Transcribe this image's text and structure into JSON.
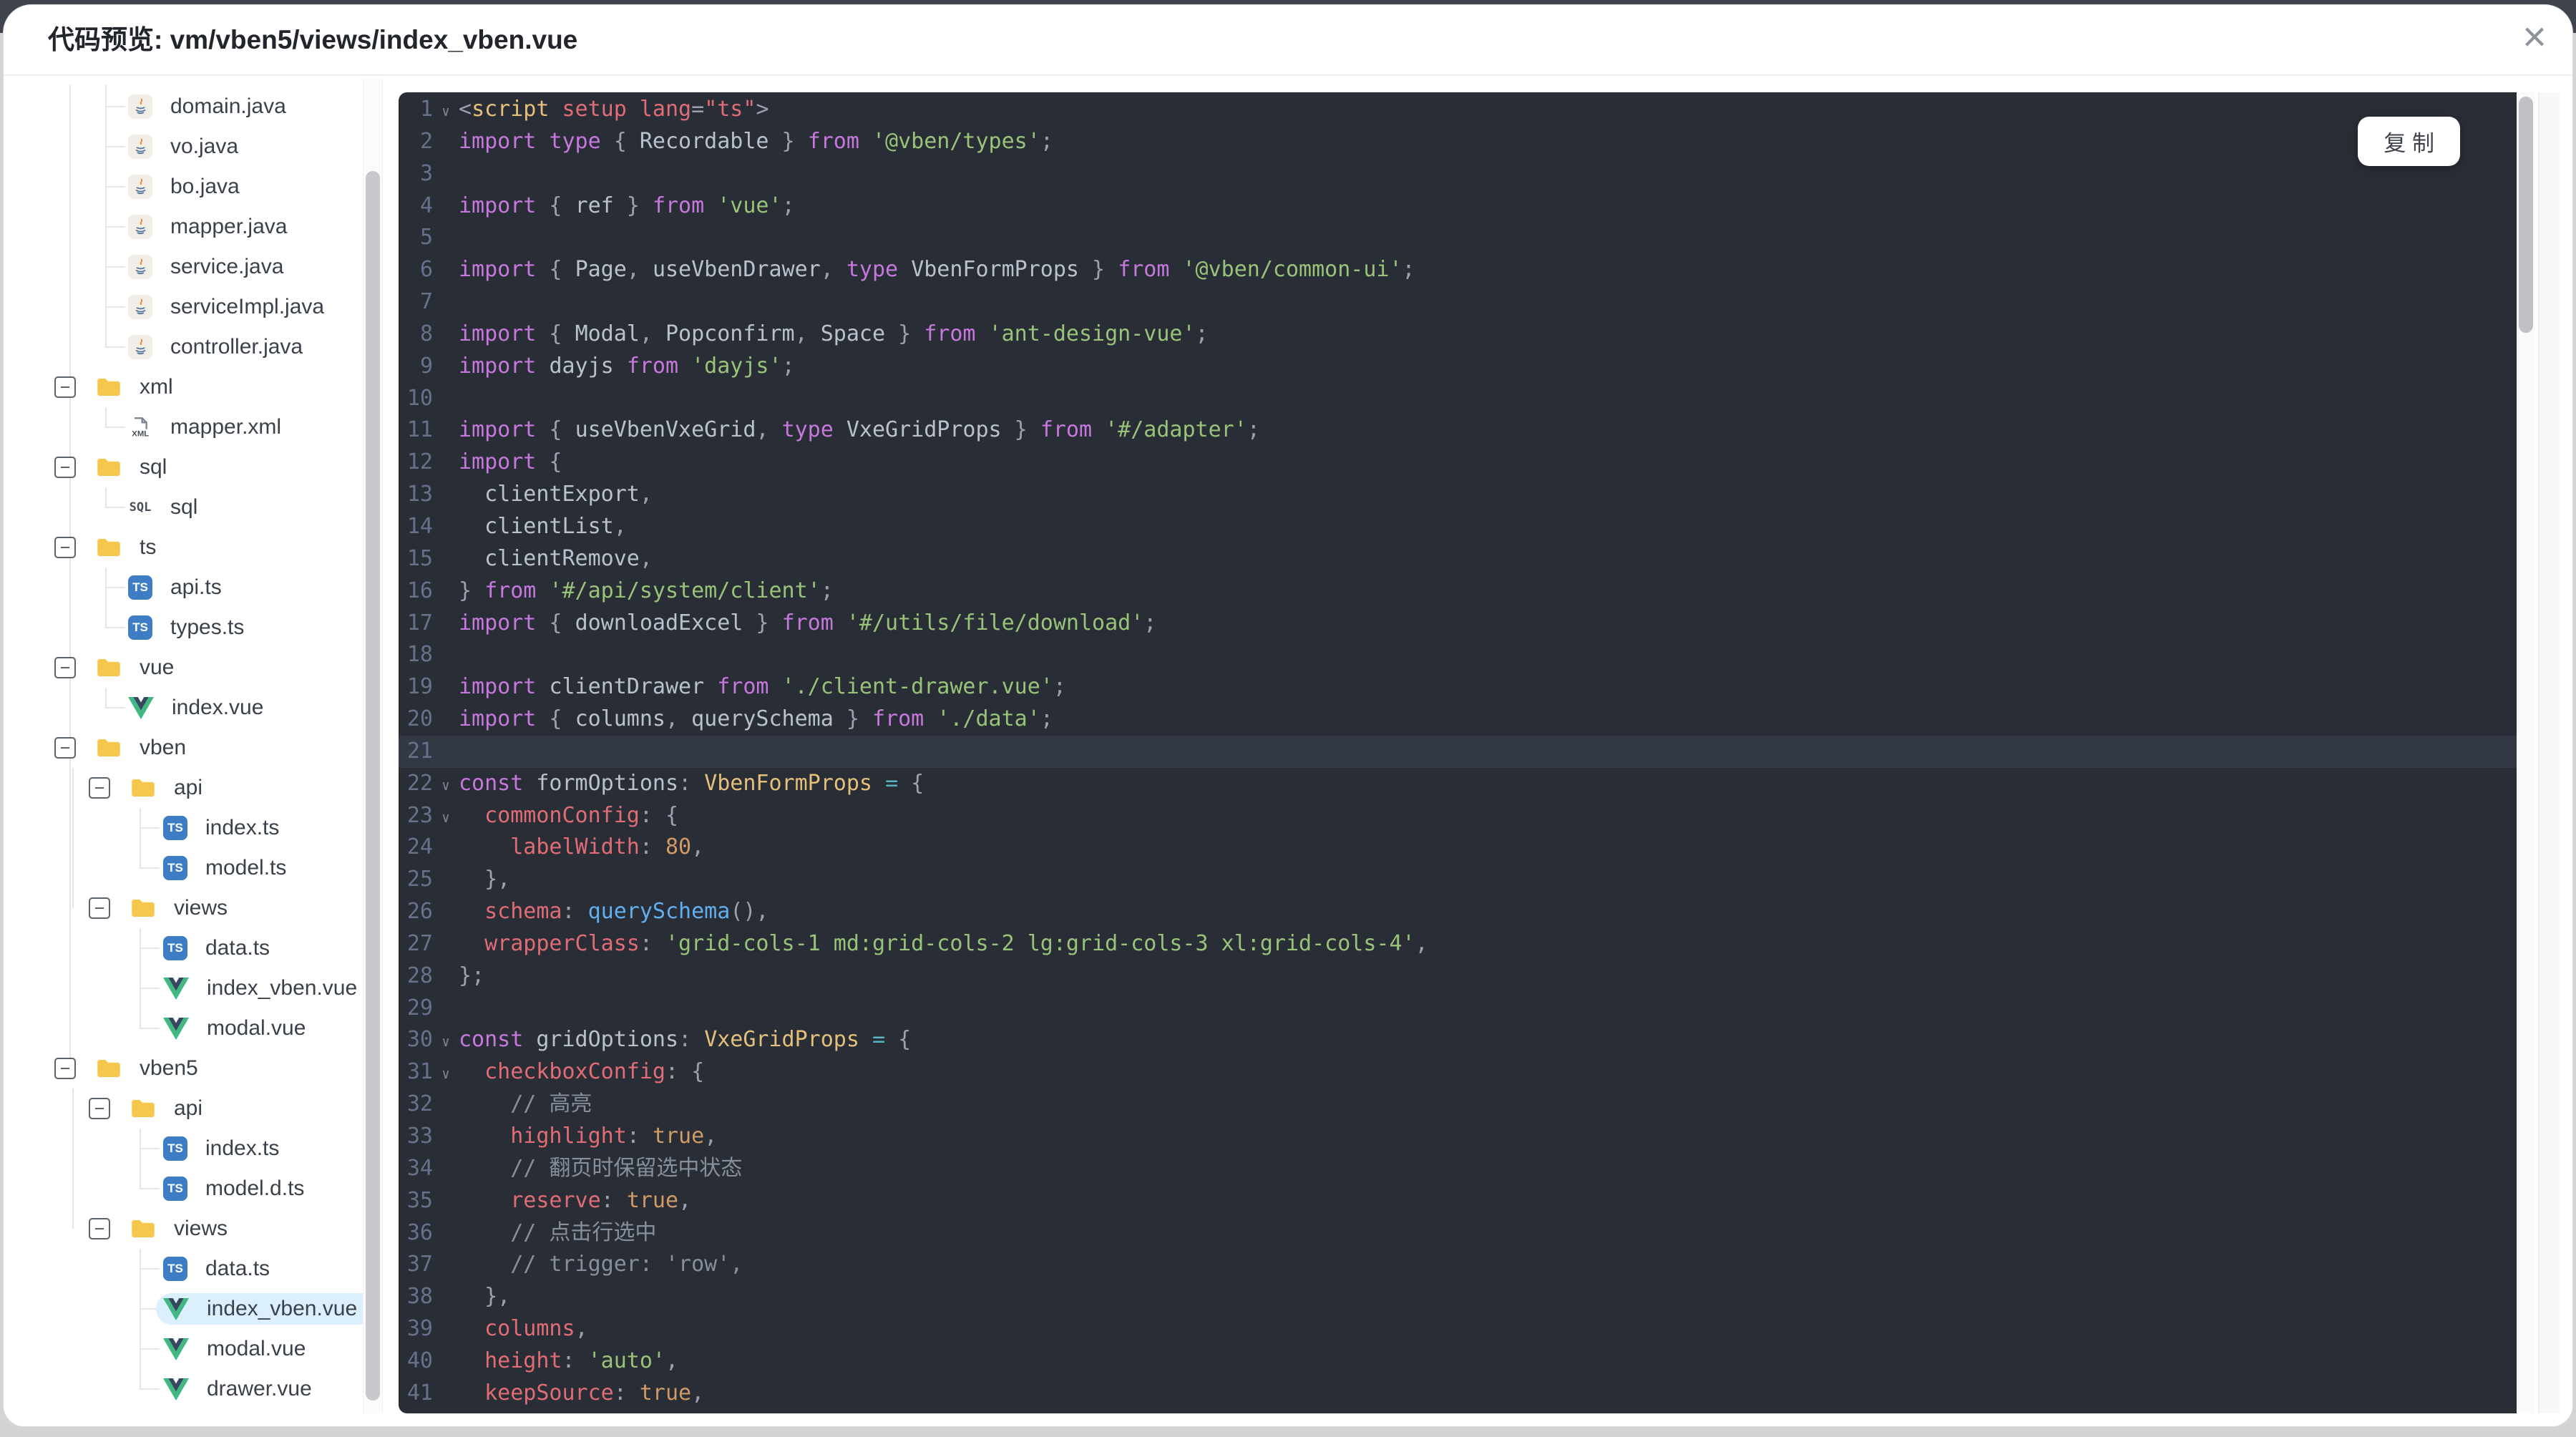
{
  "dialog": {
    "title": "代码预览: vm/vben5/views/index_vben.vue",
    "close_icon": "×"
  },
  "colors": {
    "code_background": "#292d36",
    "keyword": "#c678dd",
    "string": "#98c379",
    "property": "#e06c75",
    "number": "#d19a66",
    "type": "#e5c07b",
    "function": "#61afef",
    "selected_row_bg": "#dceffc",
    "folder_yellow": "#F7C64E",
    "ts_blue": "#3e7dc4",
    "vue_green": "#41B883"
  },
  "tree": {
    "rows": [
      {
        "label": "domain.java",
        "depth": 1,
        "kind": "java"
      },
      {
        "label": "vo.java",
        "depth": 1,
        "kind": "java"
      },
      {
        "label": "bo.java",
        "depth": 1,
        "kind": "java"
      },
      {
        "label": "mapper.java",
        "depth": 1,
        "kind": "java"
      },
      {
        "label": "service.java",
        "depth": 1,
        "kind": "java"
      },
      {
        "label": "serviceImpl.java",
        "depth": 1,
        "kind": "java"
      },
      {
        "label": "controller.java",
        "depth": 1,
        "kind": "java"
      },
      {
        "label": "xml",
        "depth": 0,
        "kind": "folder"
      },
      {
        "label": "mapper.xml",
        "depth": 1,
        "kind": "xml"
      },
      {
        "label": "sql",
        "depth": 0,
        "kind": "folder"
      },
      {
        "label": "sql",
        "depth": 1,
        "kind": "sql"
      },
      {
        "label": "ts",
        "depth": 0,
        "kind": "folder"
      },
      {
        "label": "api.ts",
        "depth": 1,
        "kind": "ts"
      },
      {
        "label": "types.ts",
        "depth": 1,
        "kind": "ts"
      },
      {
        "label": "vue",
        "depth": 0,
        "kind": "folder"
      },
      {
        "label": "index.vue",
        "depth": 1,
        "kind": "vue"
      },
      {
        "label": "vben",
        "depth": 0,
        "kind": "folder"
      },
      {
        "label": "api",
        "depth": 1,
        "kind": "folder"
      },
      {
        "label": "index.ts",
        "depth": 2,
        "kind": "ts"
      },
      {
        "label": "model.ts",
        "depth": 2,
        "kind": "ts"
      },
      {
        "label": "views",
        "depth": 1,
        "kind": "folder"
      },
      {
        "label": "data.ts",
        "depth": 2,
        "kind": "ts"
      },
      {
        "label": "index_vben.vue",
        "depth": 2,
        "kind": "vue"
      },
      {
        "label": "modal.vue",
        "depth": 2,
        "kind": "vue"
      },
      {
        "label": "vben5",
        "depth": 0,
        "kind": "folder"
      },
      {
        "label": "api",
        "depth": 1,
        "kind": "folder"
      },
      {
        "label": "index.ts",
        "depth": 2,
        "kind": "ts"
      },
      {
        "label": "model.d.ts",
        "depth": 2,
        "kind": "ts"
      },
      {
        "label": "views",
        "depth": 1,
        "kind": "folder"
      },
      {
        "label": "data.ts",
        "depth": 2,
        "kind": "ts"
      },
      {
        "label": "index_vben.vue",
        "depth": 2,
        "kind": "vue",
        "selected": true
      },
      {
        "label": "modal.vue",
        "depth": 2,
        "kind": "vue"
      },
      {
        "label": "drawer.vue",
        "depth": 2,
        "kind": "vue"
      }
    ]
  },
  "code": {
    "copy_label": "复 制",
    "lines": [
      {
        "n": 1,
        "fold": true,
        "tokens": [
          [
            "pn",
            "<"
          ],
          [
            "tag",
            "script"
          ],
          [
            "pn",
            " "
          ],
          [
            "attr",
            "setup"
          ],
          [
            "pn",
            " "
          ],
          [
            "attr",
            "lang"
          ],
          [
            "pn",
            "="
          ],
          [
            "attr",
            "\"ts\""
          ],
          [
            "pn",
            ">"
          ]
        ]
      },
      {
        "n": 2,
        "tokens": [
          [
            "kw",
            "import"
          ],
          [
            "pn",
            " "
          ],
          [
            "kw",
            "type"
          ],
          [
            "pn",
            " { "
          ],
          [
            "id",
            "Recordable"
          ],
          [
            "pn",
            " } "
          ],
          [
            "kw",
            "from"
          ],
          [
            "pn",
            " "
          ],
          [
            "str",
            "'@vben/types'"
          ],
          [
            "pn",
            ";"
          ]
        ]
      },
      {
        "n": 3,
        "tokens": []
      },
      {
        "n": 4,
        "tokens": [
          [
            "kw",
            "import"
          ],
          [
            "pn",
            " { "
          ],
          [
            "id",
            "ref"
          ],
          [
            "pn",
            " } "
          ],
          [
            "kw",
            "from"
          ],
          [
            "pn",
            " "
          ],
          [
            "str",
            "'vue'"
          ],
          [
            "pn",
            ";"
          ]
        ]
      },
      {
        "n": 5,
        "tokens": []
      },
      {
        "n": 6,
        "tokens": [
          [
            "kw",
            "import"
          ],
          [
            "pn",
            " { "
          ],
          [
            "id",
            "Page"
          ],
          [
            "pn",
            ", "
          ],
          [
            "id",
            "useVbenDrawer"
          ],
          [
            "pn",
            ", "
          ],
          [
            "kw",
            "type"
          ],
          [
            "pn",
            " "
          ],
          [
            "id",
            "VbenFormProps"
          ],
          [
            "pn",
            " } "
          ],
          [
            "kw",
            "from"
          ],
          [
            "pn",
            " "
          ],
          [
            "str",
            "'@vben/common-ui'"
          ],
          [
            "pn",
            ";"
          ]
        ]
      },
      {
        "n": 7,
        "tokens": []
      },
      {
        "n": 8,
        "tokens": [
          [
            "kw",
            "import"
          ],
          [
            "pn",
            " { "
          ],
          [
            "id",
            "Modal"
          ],
          [
            "pn",
            ", "
          ],
          [
            "id",
            "Popconfirm"
          ],
          [
            "pn",
            ", "
          ],
          [
            "id",
            "Space"
          ],
          [
            "pn",
            " } "
          ],
          [
            "kw",
            "from"
          ],
          [
            "pn",
            " "
          ],
          [
            "str",
            "'ant-design-vue'"
          ],
          [
            "pn",
            ";"
          ]
        ]
      },
      {
        "n": 9,
        "tokens": [
          [
            "kw",
            "import"
          ],
          [
            "pn",
            " "
          ],
          [
            "id",
            "dayjs"
          ],
          [
            "pn",
            " "
          ],
          [
            "kw",
            "from"
          ],
          [
            "pn",
            " "
          ],
          [
            "str",
            "'dayjs'"
          ],
          [
            "pn",
            ";"
          ]
        ]
      },
      {
        "n": 10,
        "tokens": []
      },
      {
        "n": 11,
        "tokens": [
          [
            "kw",
            "import"
          ],
          [
            "pn",
            " { "
          ],
          [
            "id",
            "useVbenVxeGrid"
          ],
          [
            "pn",
            ", "
          ],
          [
            "kw",
            "type"
          ],
          [
            "pn",
            " "
          ],
          [
            "id",
            "VxeGridProps"
          ],
          [
            "pn",
            " } "
          ],
          [
            "kw",
            "from"
          ],
          [
            "pn",
            " "
          ],
          [
            "str",
            "'#/adapter'"
          ],
          [
            "pn",
            ";"
          ]
        ]
      },
      {
        "n": 12,
        "tokens": [
          [
            "kw",
            "import"
          ],
          [
            "pn",
            " {"
          ]
        ]
      },
      {
        "n": 13,
        "tokens": [
          [
            "pn",
            "  "
          ],
          [
            "id",
            "clientExport"
          ],
          [
            "pn",
            ","
          ]
        ]
      },
      {
        "n": 14,
        "tokens": [
          [
            "pn",
            "  "
          ],
          [
            "id",
            "clientList"
          ],
          [
            "pn",
            ","
          ]
        ]
      },
      {
        "n": 15,
        "tokens": [
          [
            "pn",
            "  "
          ],
          [
            "id",
            "clientRemove"
          ],
          [
            "pn",
            ","
          ]
        ]
      },
      {
        "n": 16,
        "tokens": [
          [
            "pn",
            "} "
          ],
          [
            "kw",
            "from"
          ],
          [
            "pn",
            " "
          ],
          [
            "str",
            "'#/api/system/client'"
          ],
          [
            "pn",
            ";"
          ]
        ]
      },
      {
        "n": 17,
        "tokens": [
          [
            "kw",
            "import"
          ],
          [
            "pn",
            " { "
          ],
          [
            "id",
            "downloadExcel"
          ],
          [
            "pn",
            " } "
          ],
          [
            "kw",
            "from"
          ],
          [
            "pn",
            " "
          ],
          [
            "str",
            "'#/utils/file/download'"
          ],
          [
            "pn",
            ";"
          ]
        ]
      },
      {
        "n": 18,
        "tokens": []
      },
      {
        "n": 19,
        "tokens": [
          [
            "kw",
            "import"
          ],
          [
            "pn",
            " "
          ],
          [
            "id",
            "clientDrawer"
          ],
          [
            "pn",
            " "
          ],
          [
            "kw",
            "from"
          ],
          [
            "pn",
            " "
          ],
          [
            "str",
            "'./client-drawer.vue'"
          ],
          [
            "pn",
            ";"
          ]
        ]
      },
      {
        "n": 20,
        "tokens": [
          [
            "kw",
            "import"
          ],
          [
            "pn",
            " { "
          ],
          [
            "id",
            "columns"
          ],
          [
            "pn",
            ", "
          ],
          [
            "id",
            "querySchema"
          ],
          [
            "pn",
            " } "
          ],
          [
            "kw",
            "from"
          ],
          [
            "pn",
            " "
          ],
          [
            "str",
            "'./data'"
          ],
          [
            "pn",
            ";"
          ]
        ]
      },
      {
        "n": 21,
        "active": true,
        "tokens": []
      },
      {
        "n": 22,
        "fold": true,
        "tokens": [
          [
            "kw",
            "const"
          ],
          [
            "pn",
            " "
          ],
          [
            "id",
            "formOptions"
          ],
          [
            "pn",
            ": "
          ],
          [
            "typ",
            "VbenFormProps"
          ],
          [
            "pn",
            " "
          ],
          [
            "op",
            "="
          ],
          [
            "pn",
            " {"
          ]
        ]
      },
      {
        "n": 23,
        "fold": true,
        "tokens": [
          [
            "pn",
            "  "
          ],
          [
            "prop",
            "commonConfig"
          ],
          [
            "pn",
            ": {"
          ]
        ]
      },
      {
        "n": 24,
        "tokens": [
          [
            "pn",
            "    "
          ],
          [
            "prop",
            "labelWidth"
          ],
          [
            "pn",
            ": "
          ],
          [
            "num",
            "80"
          ],
          [
            "pn",
            ","
          ]
        ]
      },
      {
        "n": 25,
        "tokens": [
          [
            "pn",
            "  },"
          ]
        ]
      },
      {
        "n": 26,
        "tokens": [
          [
            "pn",
            "  "
          ],
          [
            "prop",
            "schema"
          ],
          [
            "pn",
            ": "
          ],
          [
            "fn",
            "querySchema"
          ],
          [
            "pn",
            "(),"
          ]
        ]
      },
      {
        "n": 27,
        "tokens": [
          [
            "pn",
            "  "
          ],
          [
            "prop",
            "wrapperClass"
          ],
          [
            "pn",
            ": "
          ],
          [
            "str",
            "'grid-cols-1 md:grid-cols-2 lg:grid-cols-3 xl:grid-cols-4'"
          ],
          [
            "pn",
            ","
          ]
        ]
      },
      {
        "n": 28,
        "tokens": [
          [
            "pn",
            "};"
          ]
        ]
      },
      {
        "n": 29,
        "tokens": []
      },
      {
        "n": 30,
        "fold": true,
        "tokens": [
          [
            "kw",
            "const"
          ],
          [
            "pn",
            " "
          ],
          [
            "id",
            "gridOptions"
          ],
          [
            "pn",
            ": "
          ],
          [
            "typ",
            "VxeGridProps"
          ],
          [
            "pn",
            " "
          ],
          [
            "op",
            "="
          ],
          [
            "pn",
            " {"
          ]
        ]
      },
      {
        "n": 31,
        "fold": true,
        "tokens": [
          [
            "pn",
            "  "
          ],
          [
            "prop",
            "checkboxConfig"
          ],
          [
            "pn",
            ": {"
          ]
        ]
      },
      {
        "n": 32,
        "tokens": [
          [
            "pn",
            "    "
          ],
          [
            "cm",
            "// 高亮"
          ]
        ]
      },
      {
        "n": 33,
        "tokens": [
          [
            "pn",
            "    "
          ],
          [
            "prop",
            "highlight"
          ],
          [
            "pn",
            ": "
          ],
          [
            "num",
            "true"
          ],
          [
            "pn",
            ","
          ]
        ]
      },
      {
        "n": 34,
        "tokens": [
          [
            "pn",
            "    "
          ],
          [
            "cm",
            "// 翻页时保留选中状态"
          ]
        ]
      },
      {
        "n": 35,
        "tokens": [
          [
            "pn",
            "    "
          ],
          [
            "prop",
            "reserve"
          ],
          [
            "pn",
            ": "
          ],
          [
            "num",
            "true"
          ],
          [
            "pn",
            ","
          ]
        ]
      },
      {
        "n": 36,
        "tokens": [
          [
            "pn",
            "    "
          ],
          [
            "cm",
            "// 点击行选中"
          ]
        ]
      },
      {
        "n": 37,
        "tokens": [
          [
            "pn",
            "    "
          ],
          [
            "cm",
            "// trigger: 'row',"
          ]
        ]
      },
      {
        "n": 38,
        "tokens": [
          [
            "pn",
            "  },"
          ]
        ]
      },
      {
        "n": 39,
        "tokens": [
          [
            "pn",
            "  "
          ],
          [
            "prop",
            "columns"
          ],
          [
            "pn",
            ","
          ]
        ]
      },
      {
        "n": 40,
        "tokens": [
          [
            "pn",
            "  "
          ],
          [
            "prop",
            "height"
          ],
          [
            "pn",
            ": "
          ],
          [
            "str",
            "'auto'"
          ],
          [
            "pn",
            ","
          ]
        ]
      },
      {
        "n": 41,
        "tokens": [
          [
            "pn",
            "  "
          ],
          [
            "prop",
            "keepSource"
          ],
          [
            "pn",
            ": "
          ],
          [
            "num",
            "true"
          ],
          [
            "pn",
            ","
          ]
        ]
      }
    ]
  }
}
